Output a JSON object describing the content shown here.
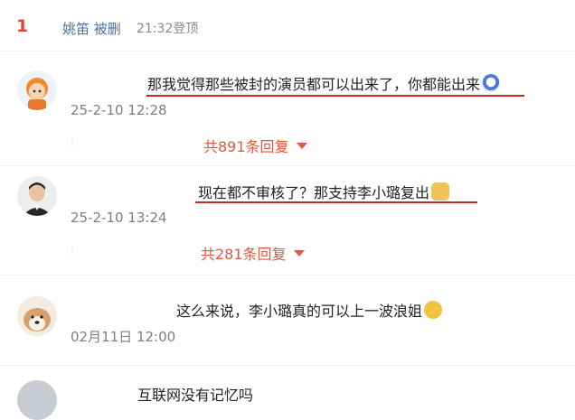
{
  "header": {
    "rank": "1",
    "user": "姚笛 被删",
    "time": "21:32登顶"
  },
  "comments": [
    {
      "text": "那我觉得那些被封的演员都可以出来了，你都能出来",
      "emoji": "laugh-cry-emoji",
      "date": "25-2-10 12:28",
      "replies": "共891条回复",
      "underline_color": "#c32b23"
    },
    {
      "text": "现在都不审核了？那支持李小璐复出",
      "emoji": "doge-emoji",
      "date": "25-2-10 13:24",
      "replies": "共281条回复",
      "underline_color": "#c32b23"
    },
    {
      "text": "这么来说，李小璐真的可以上一波浪姐",
      "emoji": "thinking-emoji",
      "date": "02月11日 12:00"
    },
    {
      "text": "互联网没有记忆吗"
    }
  ],
  "colors": {
    "accent": "#e2583e",
    "rank": "#e8412c",
    "link": "#4a6fa0"
  }
}
